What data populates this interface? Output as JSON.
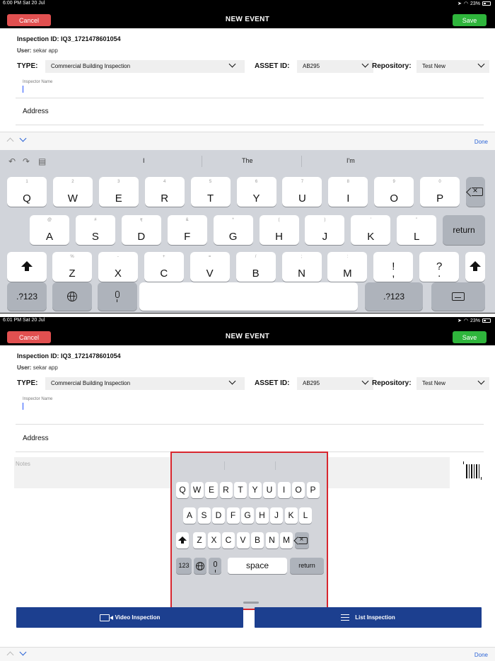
{
  "screens": [
    {
      "status_time": "6:00 PM  Sat 20 Jul",
      "status_battery": "23%",
      "suggestions": [
        "I",
        "The",
        "I'm"
      ]
    },
    {
      "status_time": "6:01 PM  Sat 20 Jul",
      "status_battery": "23%"
    }
  ],
  "nav": {
    "cancel_label": "Cancel",
    "title": "NEW EVENT",
    "save_label": "Save"
  },
  "form": {
    "inspection_id": "Inspection ID: IQ3_1721478601054",
    "user_label": "User:",
    "user_value": "sekar app",
    "type_label": "TYPE:",
    "type_value": "Commercial Building Inspection",
    "asset_label": "ASSET ID:",
    "asset_value": "AB295",
    "repository_label": "Repository:",
    "repository_value": "Test New",
    "inspector_name_label": "Inspector Name",
    "address_label": "Address",
    "notes_placeholder": "Notes"
  },
  "keyboard_toolbar": {
    "done_label": "Done"
  },
  "keyboard_full": {
    "row1": [
      {
        "k": "Q",
        "a": "1"
      },
      {
        "k": "W",
        "a": "2"
      },
      {
        "k": "E",
        "a": "3"
      },
      {
        "k": "R",
        "a": "4"
      },
      {
        "k": "T",
        "a": "5"
      },
      {
        "k": "Y",
        "a": "6"
      },
      {
        "k": "U",
        "a": "7"
      },
      {
        "k": "I",
        "a": "8"
      },
      {
        "k": "O",
        "a": "9"
      },
      {
        "k": "P",
        "a": "0"
      }
    ],
    "row2": [
      {
        "k": "A",
        "a": "@"
      },
      {
        "k": "S",
        "a": "#"
      },
      {
        "k": "D",
        "a": "₹"
      },
      {
        "k": "F",
        "a": "&"
      },
      {
        "k": "G",
        "a": "*"
      },
      {
        "k": "H",
        "a": "("
      },
      {
        "k": "J",
        "a": ")"
      },
      {
        "k": "K",
        "a": "'"
      },
      {
        "k": "L",
        "a": "\""
      }
    ],
    "row3": [
      {
        "k": "Z",
        "a": "%"
      },
      {
        "k": "X",
        "a": "-"
      },
      {
        "k": "C",
        "a": "+"
      },
      {
        "k": "V",
        "a": "="
      },
      {
        "k": "B",
        "a": "/"
      },
      {
        "k": "N",
        "a": ";"
      },
      {
        "k": "M",
        "a": ":"
      },
      {
        "k": "!\n,",
        "a": ""
      },
      {
        "k": "?\n.",
        "a": ""
      }
    ],
    "return_label": "return",
    "numbers_label": ".?123"
  },
  "keyboard_floating": {
    "row1": [
      "Q",
      "W",
      "E",
      "R",
      "T",
      "Y",
      "U",
      "I",
      "O",
      "P"
    ],
    "row2": [
      "A",
      "S",
      "D",
      "F",
      "G",
      "H",
      "J",
      "K",
      "L"
    ],
    "row3": [
      "Z",
      "X",
      "C",
      "V",
      "B",
      "N",
      "M"
    ],
    "numbers_label": "123",
    "space_label": "space",
    "return_label": "return"
  },
  "actions": {
    "video_label": "Video Inspection",
    "list_label": "List Inspection"
  },
  "colors": {
    "cancel": "#e15050",
    "save": "#2fb53c",
    "action_blue": "#1c3f8f",
    "highlight_border": "#d8262e"
  },
  "icons": [
    "undo-icon",
    "redo-icon",
    "clipboard-icon",
    "shift-icon",
    "delete-icon",
    "globe-icon",
    "mic-icon",
    "keyboard-dismiss-icon",
    "barcode-icon",
    "video-icon",
    "list-icon",
    "chevron-down-icon",
    "chevron-up-icon"
  ]
}
